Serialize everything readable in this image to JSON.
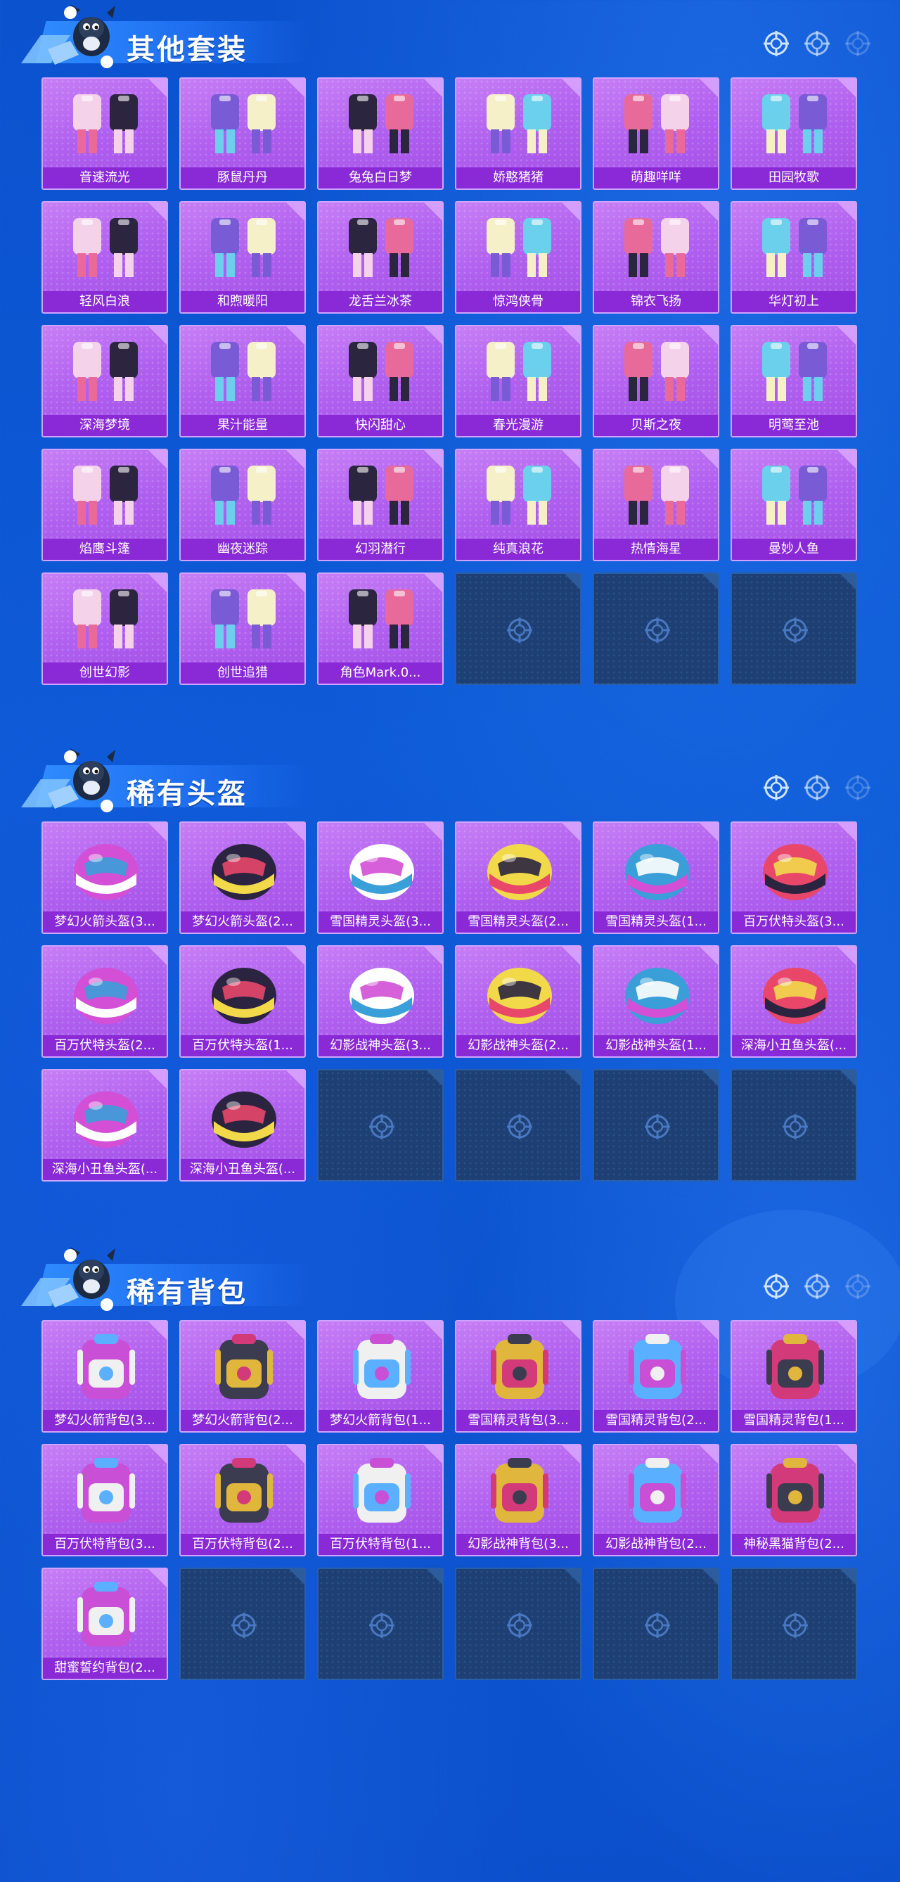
{
  "colors": {
    "background": "#0c55d2",
    "card_purple": "#b060ef",
    "label_purple": "#8a2ad6",
    "empty_slot": "#1d3f73",
    "title_text": "#ffffff"
  },
  "sections": [
    {
      "title": "其他套装",
      "icon": "mascot-icon",
      "items": [
        "音速流光",
        "豚鼠丹丹",
        "兔兔白日梦",
        "娇憨猪猪",
        "萌趣咩咩",
        "田园牧歌",
        "轻风白浪",
        "和煦暖阳",
        "龙舌兰冰茶",
        "惊鸿侠骨",
        "锦衣飞扬",
        "华灯初上",
        "深海梦境",
        "果汁能量",
        "快闪甜心",
        "春光漫游",
        "贝斯之夜",
        "明莺至池",
        "焰鹰斗篷",
        "幽夜迷踪",
        "幻羽潜行",
        "纯真浪花",
        "热情海星",
        "曼妙人鱼",
        "创世幻影",
        "创世追猎",
        "角色Mark.0..."
      ],
      "empty_slots": 3
    },
    {
      "title": "稀有头盔",
      "icon": "mascot-icon",
      "items": [
        "梦幻火箭头盔(3...",
        "梦幻火箭头盔(2...",
        "雪国精灵头盔(3...",
        "雪国精灵头盔(2...",
        "雪国精灵头盔(1...",
        "百万伏特头盔(3...",
        "百万伏特头盔(2...",
        "百万伏特头盔(1...",
        "幻影战神头盔(3...",
        "幻影战神头盔(2...",
        "幻影战神头盔(1...",
        "深海小丑鱼头盔(...",
        "深海小丑鱼头盔(...",
        "深海小丑鱼头盔(..."
      ],
      "empty_slots": 4
    },
    {
      "title": "稀有背包",
      "icon": "mascot-icon",
      "items": [
        "梦幻火箭背包(3...",
        "梦幻火箭背包(2...",
        "梦幻火箭背包(1...",
        "雪国精灵背包(3...",
        "雪国精灵背包(2...",
        "雪国精灵背包(1...",
        "百万伏特背包(3...",
        "百万伏特背包(2...",
        "百万伏特背包(1...",
        "幻影战神背包(3...",
        "幻影战神背包(2...",
        "神秘黑猫背包(2...",
        "甜蜜誓约背包(2..."
      ],
      "empty_slots": 5
    }
  ]
}
